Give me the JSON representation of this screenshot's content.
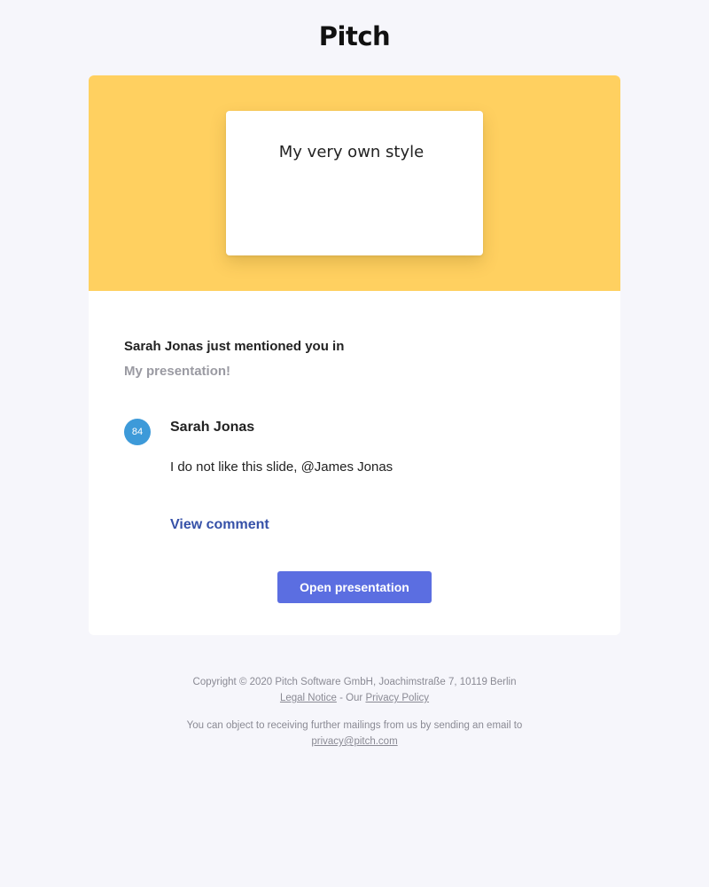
{
  "header": {
    "logo_text": "Pitch"
  },
  "hero": {
    "background_color": "#ffd060",
    "slide_title": "My very own style"
  },
  "notification": {
    "headline": "Sarah Jonas just mentioned you in",
    "presentation_name": "My presentation!"
  },
  "comment": {
    "avatar_initials": "84",
    "avatar_color": "#3d9ad9",
    "author": "Sarah Jonas",
    "text": "I do not like this slide, @James Jonas",
    "view_link": "View comment"
  },
  "actions": {
    "open_presentation": "Open presentation",
    "button_color": "#5b6ee1"
  },
  "footer": {
    "copyright": "Copyright © 2020 Pitch Software GmbH, Joachimstraße 7, 10119 Berlin",
    "legal_notice": "Legal Notice",
    "separator": " - Our ",
    "privacy_policy": "Privacy Policy",
    "object_text": "You can object to receiving further mailings from us by sending an email to",
    "privacy_email": "privacy@pitch.com"
  }
}
